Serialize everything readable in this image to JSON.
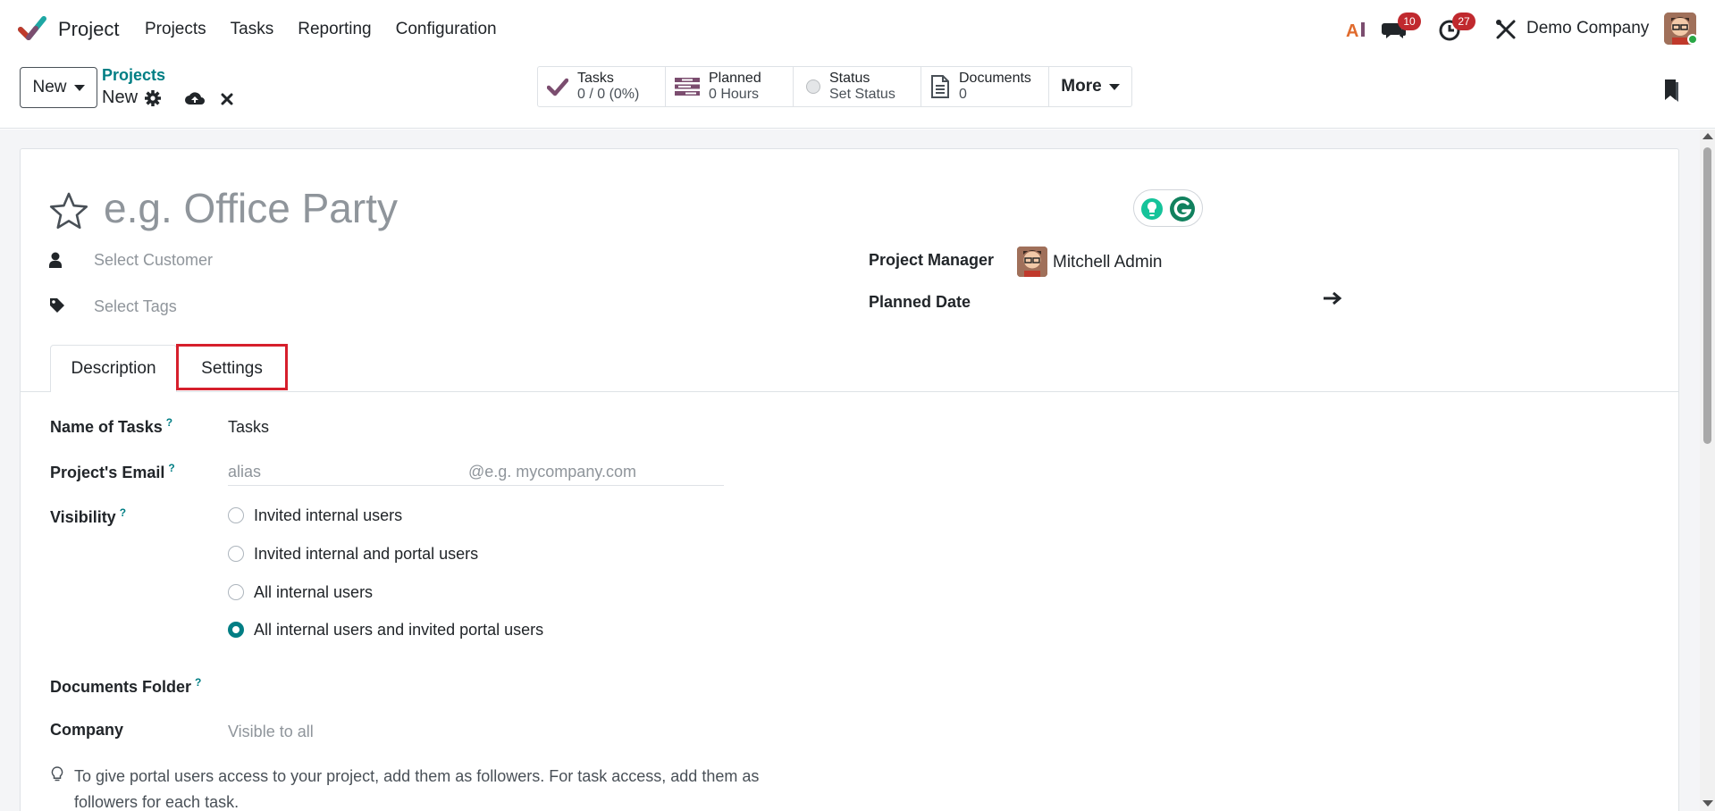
{
  "navbar": {
    "app_name": "Project",
    "menu": [
      "Projects",
      "Tasks",
      "Reporting",
      "Configuration"
    ],
    "messages_count": "10",
    "activities_count": "27",
    "company": "Demo Company",
    "icons": [
      "ai-icon",
      "chat-icon",
      "clock-icon",
      "debug-tools-icon"
    ]
  },
  "control_panel": {
    "new_label": "New",
    "breadcrumb_parent": "Projects",
    "breadcrumb_current": "New",
    "stats": {
      "tasks_label": "Tasks",
      "tasks_value": "0 / 0 (0%)",
      "planned_label": "Planned",
      "planned_value": "0 Hours",
      "status_label": "Status",
      "status_value": "Set Status",
      "documents_label": "Documents",
      "documents_value": "0",
      "more_label": "More"
    }
  },
  "form": {
    "title_placeholder": "e.g. Office Party",
    "customer_placeholder": "Select Customer",
    "tags_placeholder": "Select Tags",
    "project_manager_label": "Project Manager",
    "project_manager_value": "Mitchell Admin",
    "planned_date_label": "Planned Date"
  },
  "tabs": {
    "description": "Description",
    "settings": "Settings",
    "active": "Settings"
  },
  "settings": {
    "name_of_tasks_label": "Name of Tasks",
    "name_of_tasks_value": "Tasks",
    "email_label": "Project's Email",
    "email_alias_placeholder": "alias",
    "email_domain_placeholder": "@e.g. mycompany.com",
    "visibility_label": "Visibility",
    "visibility_options": [
      "Invited internal users",
      "Invited internal and portal users",
      "All internal users",
      "All internal users and invited portal users"
    ],
    "visibility_selected": "All internal users and invited portal users",
    "documents_folder_label": "Documents Folder",
    "company_label": "Company",
    "company_placeholder": "Visible to all",
    "help_marker": "?",
    "hint": "To give portal users access to your project, add them as followers. For task access, add them as followers for each task."
  },
  "colors": {
    "accent": "#017e84",
    "highlight": "#d61f2c",
    "badge": "#c0292e",
    "brand": "#714b67"
  }
}
